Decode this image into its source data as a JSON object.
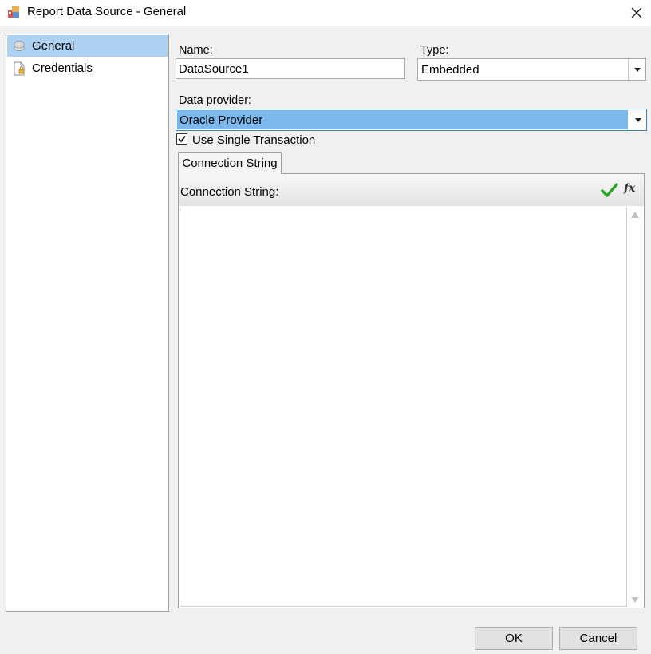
{
  "window": {
    "title": "Report Data Source - General",
    "close_glyph": "✕"
  },
  "sidebar": {
    "items": [
      {
        "label": "General",
        "icon": "database-icon",
        "selected": true
      },
      {
        "label": "Credentials",
        "icon": "document-lock-icon",
        "selected": false
      }
    ]
  },
  "form": {
    "name_label": "Name:",
    "name_value": "DataSource1",
    "type_label": "Type:",
    "type_value": "Embedded",
    "provider_label": "Data provider:",
    "provider_value": "Oracle Provider",
    "single_transaction_label": "Use Single Transaction",
    "single_transaction_checked": true
  },
  "tabs": [
    {
      "label": "Connection String",
      "active": true
    }
  ],
  "connection": {
    "header_label": "Connection String:",
    "value": "",
    "fx_label": "fx"
  },
  "buttons": {
    "ok": "OK",
    "cancel": "Cancel"
  },
  "colors": {
    "selection": "#aed2f3",
    "provider_highlight": "#7db8ec",
    "check_green": "#2aa52a"
  }
}
